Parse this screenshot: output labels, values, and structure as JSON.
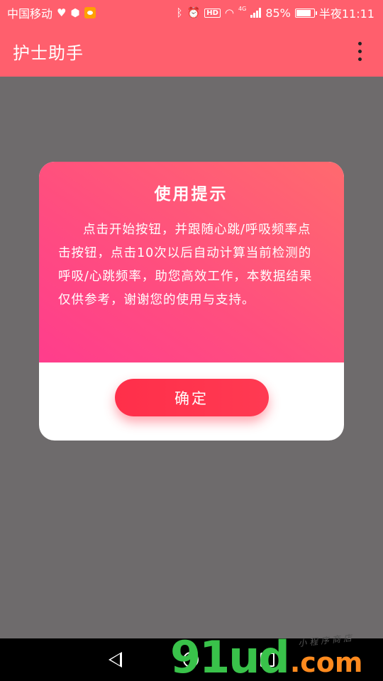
{
  "status_bar": {
    "carrier": "中国移动",
    "network_type": "4G",
    "battery_percent": "85%",
    "battery_level": 0.85,
    "time": "半夜11:11",
    "hd_label": "HD",
    "icons": [
      "heart-rate-icon",
      "mask-icon",
      "weibo-icon",
      "bluetooth-icon",
      "alarm-icon",
      "hd-icon",
      "wifi-icon",
      "signal-icon",
      "battery-icon"
    ]
  },
  "app_bar": {
    "title": "护士助手",
    "menu_icon": "more-vert-icon"
  },
  "dialog": {
    "title": "使用提示",
    "body": "点击开始按钮，并跟随心跳/呼吸频率点击按钮，点击10次以后自动计算当前检测的呼吸/心跳频率，助您高效工作，本数据结果仅供参考，谢谢您的使用与支持。",
    "confirm_label": "确定"
  },
  "nav_bar": {
    "icons": [
      "back-icon",
      "home-icon",
      "recent-apps-icon"
    ]
  },
  "watermark": {
    "main": "91ud",
    "suffix": ".com",
    "small": "小程序商店"
  },
  "colors": {
    "accent": "#ff5f6d",
    "overlay": "#6e6b6c",
    "dialog_gradient_start": "#ff3d8c",
    "dialog_gradient_end": "#ff6a6e",
    "button": "#ff2f4a"
  }
}
